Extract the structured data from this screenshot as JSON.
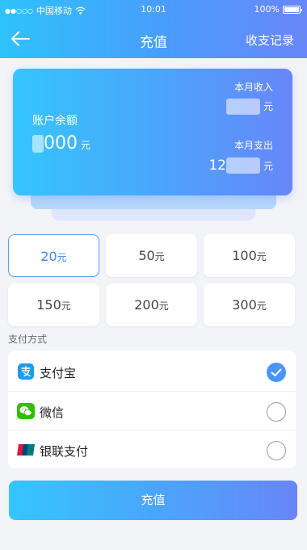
{
  "status_bar": {
    "carrier": "中国移动",
    "time": "10:01",
    "battery": "100%"
  },
  "nav": {
    "title": "充值",
    "right_label": "收支记录"
  },
  "account_card": {
    "balance_label": "账户余额",
    "balance_visible": "000",
    "balance_unit": "元",
    "income_label": "本月收入",
    "income_unit": "元",
    "expense_label": "本月支出",
    "expense_visible": "12",
    "expense_unit": "元"
  },
  "amount_unit": "元",
  "amounts": [
    {
      "value": "20",
      "selected": true
    },
    {
      "value": "50",
      "selected": false
    },
    {
      "value": "100",
      "selected": false
    },
    {
      "value": "150",
      "selected": false
    },
    {
      "value": "200",
      "selected": false
    },
    {
      "value": "300",
      "selected": false
    }
  ],
  "payment": {
    "section_title": "支付方式",
    "methods": [
      {
        "name": "支付宝",
        "icon": "alipay-icon",
        "selected": true
      },
      {
        "name": "微信",
        "icon": "wechat-icon",
        "selected": false
      },
      {
        "name": "银联支付",
        "icon": "unionpay-icon",
        "selected": false
      }
    ]
  },
  "submit_label": "充值",
  "colors": {
    "accent": "#4b95f8",
    "gradient_start": "#34c6fd",
    "gradient_end": "#6886f8"
  }
}
